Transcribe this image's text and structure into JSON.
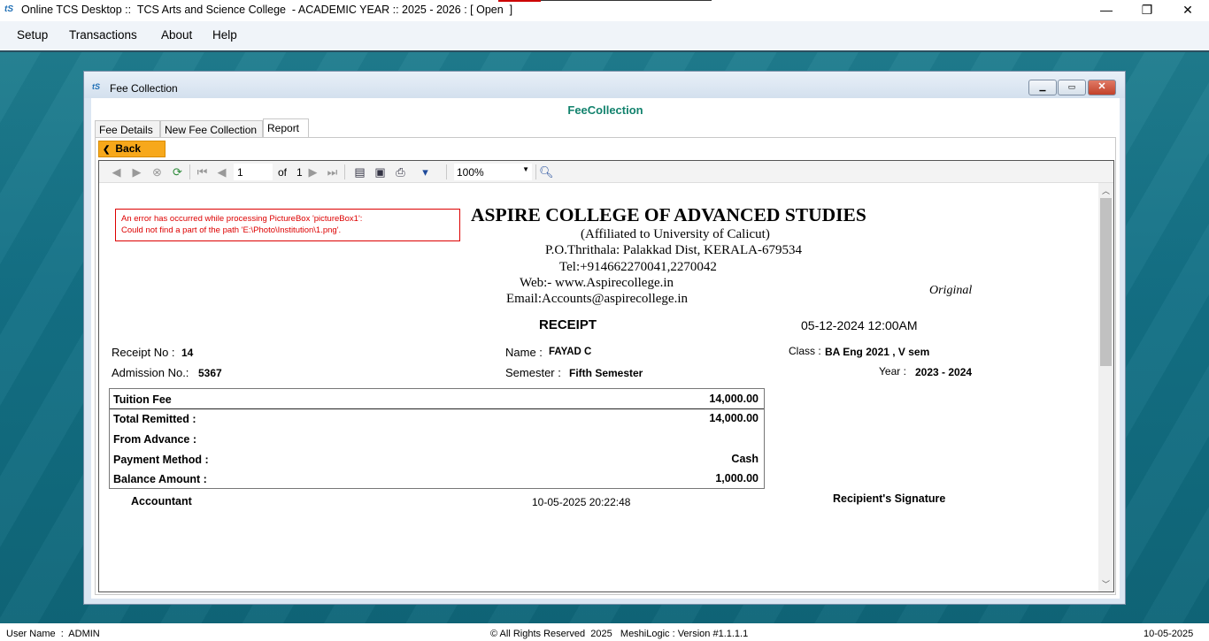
{
  "app": {
    "logo": "tS",
    "title": "Online TCS Desktop ::  TCS Arts and Science College  - ACADEMIC YEAR :: 2025 - 2026 : [ Open  ]",
    "minimize": "—",
    "maximize": "❐",
    "close": "✕"
  },
  "menu": [
    "Setup",
    "Transactions",
    "About",
    "Help"
  ],
  "child_window": {
    "logo": "tS",
    "title": "Fee Collection",
    "heading": "FeeCollection",
    "tabs": [
      "Fee Details",
      "New Fee Collection",
      "Report"
    ],
    "active_tab": "Report",
    "back_label": "Back"
  },
  "viewer": {
    "page_current": "1",
    "page_of": "of",
    "page_total": "1",
    "zoom": "100%"
  },
  "report": {
    "error_line1": "An error has occurred while processing PictureBox 'pictureBox1':",
    "error_line2": "Could not find a part of the path 'E:\\Photo\\Institution\\1.png'.",
    "college_name": "ASPIRE COLLEGE OF ADVANCED STUDIES",
    "affiliation": "(Affiliated to University of Calicut)",
    "address": "P.O.Thrithala: Palakkad Dist, KERALA-679534",
    "tel": "Tel:+914662270041,2270042",
    "web": "Web:- www.Aspirecollege.in",
    "email": "Email:Accounts@aspirecollege.in",
    "copy_type": "Original",
    "title": "RECEIPT",
    "date": "05-12-2024 12:00AM",
    "receipt_no_label": "Receipt No :",
    "receipt_no": "14",
    "admission_label": "Admission No.:",
    "admission_no": "5367",
    "name_label": "Name :",
    "name": "FAYAD C",
    "semester_label": "Semester :",
    "semester": "Fifth Semester",
    "class_label": "Class :",
    "class": "BA Eng 2021 , V sem",
    "year_label": "Year :",
    "year": "2023 - 2024",
    "fees": [
      {
        "label": "Tuition Fee",
        "value": "14,000.00"
      },
      {
        "label": "Total Remitted :",
        "value": "14,000.00"
      },
      {
        "label": "From Advance :",
        "value": ""
      },
      {
        "label": "Payment Method :",
        "value": "Cash"
      },
      {
        "label": "Balance Amount :",
        "value": "1,000.00"
      }
    ],
    "accountant": "Accountant",
    "printed_at": "10-05-2025 20:22:48",
    "signature": "Recipient's Signature"
  },
  "status": {
    "user": "User Name  :  ADMIN",
    "copyright": "© All Rights Reserved  2025   MeshiLogic : Version #1.1.1.1",
    "date": "10-05-2025"
  }
}
